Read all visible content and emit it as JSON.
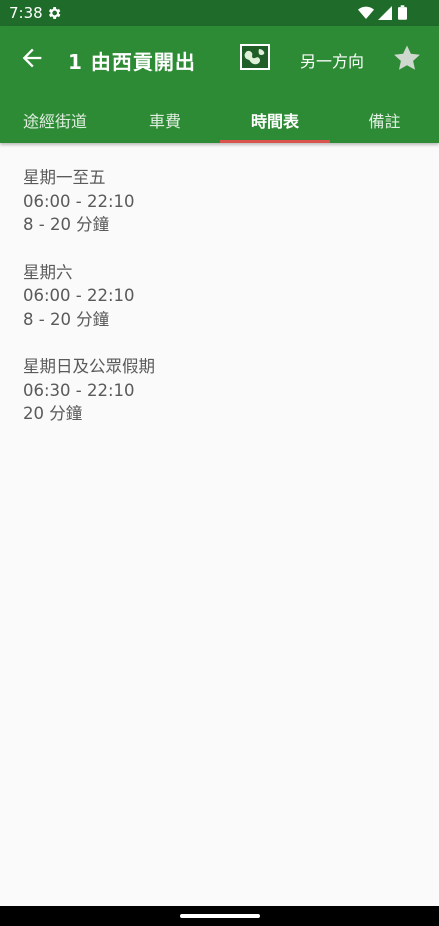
{
  "status_bar": {
    "time": "7:38",
    "icons": [
      "gear-icon",
      "wifi-icon",
      "cell-signal-icon",
      "battery-icon"
    ]
  },
  "app_bar": {
    "title": "1 由西貢開出",
    "map_icon": "map-icon",
    "direction_label": "另一方向",
    "favorite_icon": "star-icon",
    "colors": {
      "primary": "#2e8b35",
      "status": "#1f6b2a",
      "indicator": "#d9534f"
    }
  },
  "tabs": [
    {
      "label": "途經街道",
      "active": false
    },
    {
      "label": "車費",
      "active": false
    },
    {
      "label": "時間表",
      "active": true
    },
    {
      "label": "備註",
      "active": false
    }
  ],
  "timetable": [
    {
      "day": "星期一至五",
      "hours": "06:00 - 22:10",
      "frequency": "8 - 20 分鐘"
    },
    {
      "day": "星期六",
      "hours": "06:00 - 22:10",
      "frequency": "8 - 20 分鐘"
    },
    {
      "day": "星期日及公眾假期",
      "hours": "06:30 - 22:10",
      "frequency": "20 分鐘"
    }
  ]
}
